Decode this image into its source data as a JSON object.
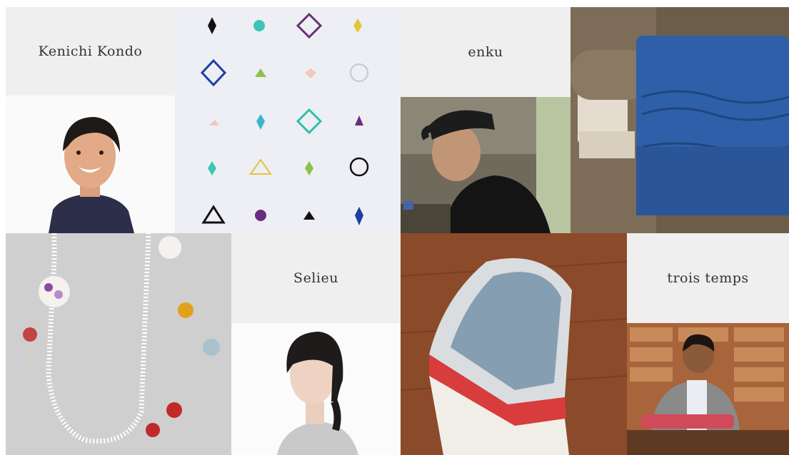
{
  "artists": [
    {
      "name": "Kenichi Kondo"
    },
    {
      "name": "enku"
    },
    {
      "name": "Selieu"
    },
    {
      "name": "trois temps"
    }
  ],
  "colors": {
    "label_bg": "#efefef",
    "label_text": "#333333",
    "page_bg": "#ffffff"
  }
}
